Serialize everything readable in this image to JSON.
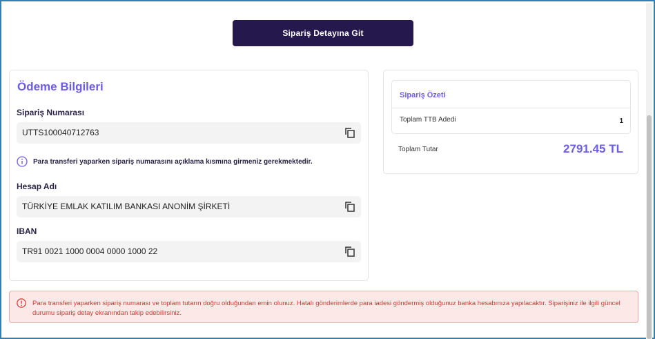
{
  "top_button": {
    "label": "Sipariş Detayına Git"
  },
  "payment": {
    "title": "Ödeme Bilgileri",
    "order_number": {
      "label": "Sipariş Numarası",
      "value": "UTTS100040712763"
    },
    "info_note": "Para transferi yaparken sipariş numarasını açıklama kısmına girmeniz gerekmektedir.",
    "account_name": {
      "label": "Hesap Adı",
      "value": "TÜRKİYE EMLAK KATILIM BANKASI ANONİM ŞİRKETİ"
    },
    "iban": {
      "label": "IBAN",
      "value": "TR91 0021 1000 0004 0000 1000 22"
    }
  },
  "summary": {
    "title": "Sipariş Özeti",
    "ttb_count_label": "Toplam TTB Adedi",
    "ttb_count_value": "1",
    "total_label": "Toplam Tutar",
    "total_value": "2791.45 TL"
  },
  "alert": {
    "text": "Para transferi yaparken sipariş numarası ve toplam tutarın doğru olduğundan emin olunuz. Hatalı gönderimlerde para iadesi göndermiş olduğunuz banka hesabınıza yapılacaktır. Siparişiniz ile ilgili güncel durumu sipariş detay ekranından takip edebilirsiniz."
  },
  "colors": {
    "primary_dark": "#25184d",
    "accent_purple": "#6c5ce7",
    "alert_red": "#e03434",
    "alert_bg": "#fde8e8"
  },
  "icons": {
    "copy": "copy-icon",
    "info": "info-icon",
    "alert": "alert-circle-icon"
  }
}
